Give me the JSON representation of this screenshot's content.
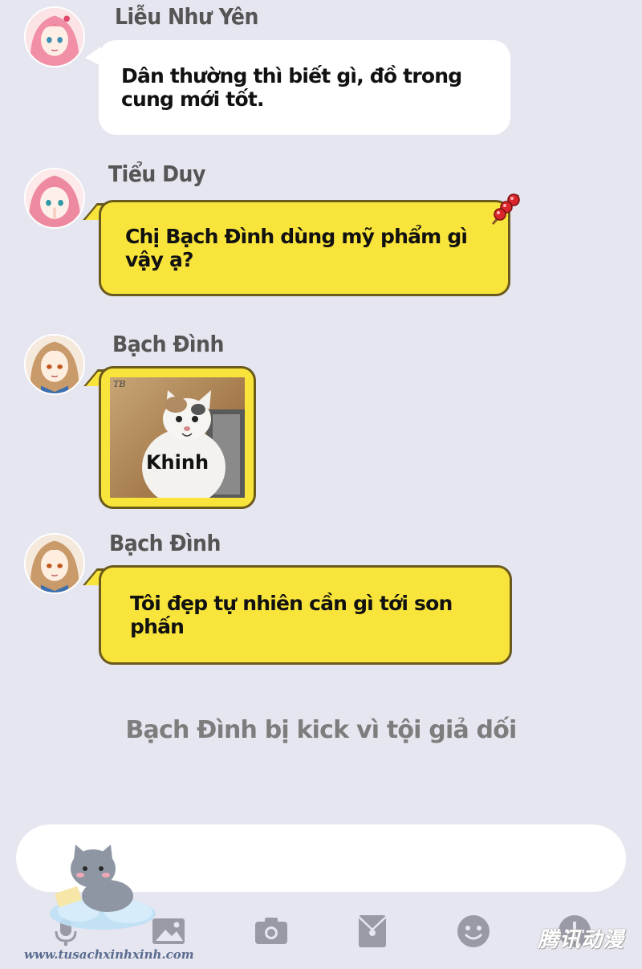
{
  "messages": [
    {
      "sender": "Liễu Như Yên",
      "text": "Dân thường thì biết gì, đồ trong cung mới tốt.",
      "style": "white"
    },
    {
      "sender": "Tiểu Duy",
      "text": "Chị Bạch Đình dùng mỹ phẩm gì vậy ạ?",
      "style": "yellow"
    },
    {
      "sender": "Bạch Đình",
      "sticker_caption": "Khinh",
      "style": "sticker"
    },
    {
      "sender": "Bạch Đình",
      "text": "Tôi đẹp tự nhiên cần gì tới son phấn",
      "style": "yellow"
    }
  ],
  "system_notice": "Bạch Đình bị kick vì tội giả dối",
  "composer": {
    "value": ""
  },
  "toolbar": {
    "icons": [
      "image-icon",
      "camera-icon",
      "red-envelope-icon",
      "emoji-icon",
      "plus-icon"
    ]
  },
  "colors": {
    "background": "#e6e6f0",
    "bubble_white": "#ffffff",
    "bubble_yellow": "#f8e43a",
    "bubble_border": "#6b5a1e",
    "toolbar_icon": "#9a9aa6"
  }
}
